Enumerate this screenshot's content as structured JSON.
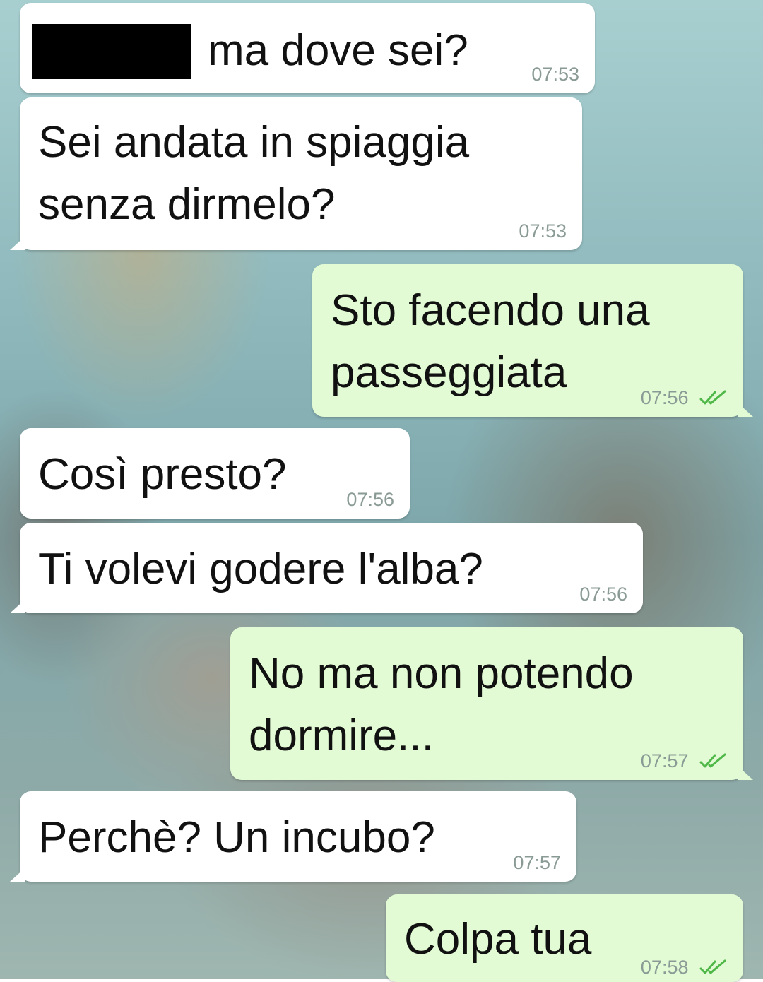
{
  "conversation": {
    "messages": [
      {
        "direction": "in",
        "text": "ma dove sei?",
        "time": "07:53",
        "redacted_prefix": true
      },
      {
        "direction": "in",
        "text": "Sei andata in spiaggia\nsenza dirmelo?",
        "time": "07:53"
      },
      {
        "direction": "out",
        "text": "Sto facendo una\npasseggiata",
        "time": "07:56",
        "status": "read"
      },
      {
        "direction": "in",
        "text": "Così presto?",
        "time": "07:56"
      },
      {
        "direction": "in",
        "text": "Ti volevi godere l'alba?",
        "time": "07:56"
      },
      {
        "direction": "out",
        "text": "No ma non potendo\ndormire...",
        "time": "07:57",
        "status": "read"
      },
      {
        "direction": "in",
        "text": "Perchè? Un incubo?",
        "time": "07:57"
      },
      {
        "direction": "out",
        "text": "Colpa tua",
        "time": "07:58",
        "status": "read"
      }
    ]
  },
  "colors": {
    "incoming_bubble": "#ffffff",
    "outgoing_bubble": "#e2fbd4",
    "read_ticks": "#4fb848",
    "timestamp": "#8a9a95"
  },
  "icons": {
    "read_status": "double-check-icon"
  }
}
